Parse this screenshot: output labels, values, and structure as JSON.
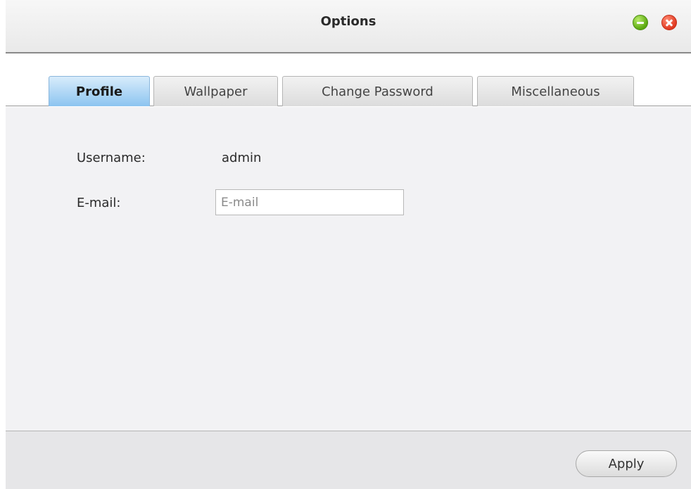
{
  "window": {
    "title": "Options"
  },
  "tabs": [
    {
      "label": "Profile",
      "active": true
    },
    {
      "label": "Wallpaper",
      "active": false
    },
    {
      "label": "Change Password",
      "active": false
    },
    {
      "label": "Miscellaneous",
      "active": false
    }
  ],
  "profile": {
    "username_label": "Username:",
    "username_value": "admin",
    "email_label": "E-mail:",
    "email_value": "",
    "email_placeholder": "E-mail"
  },
  "footer": {
    "apply_label": "Apply"
  },
  "icons": {
    "minimize": "minimize-icon",
    "close": "close-icon"
  },
  "colors": {
    "active_tab": "#8cc4f0",
    "minimize_button": "#5aa80e",
    "close_button": "#e03a22"
  }
}
